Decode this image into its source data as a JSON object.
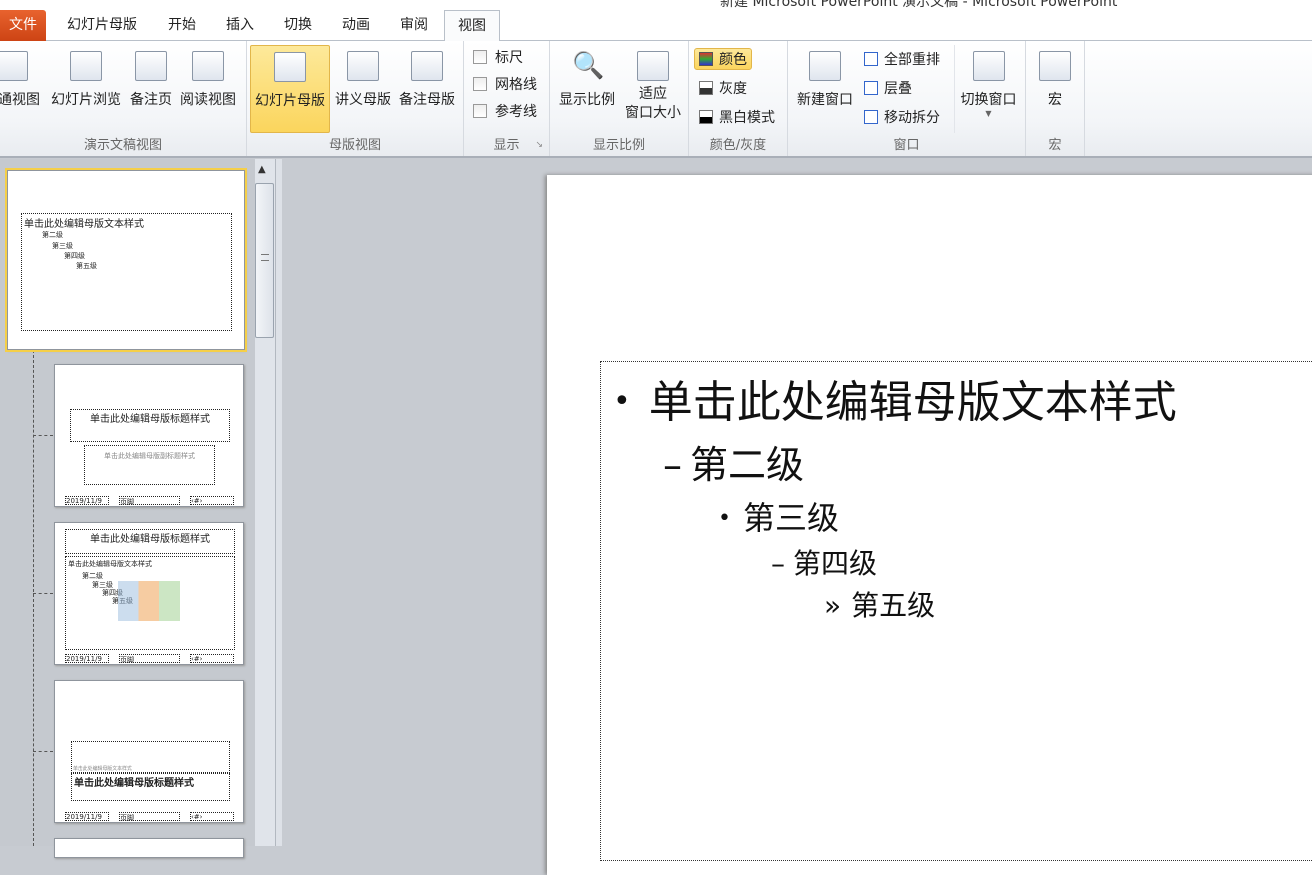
{
  "window": {
    "title": "新建 Microsoft PowerPoint 演示文稿 - Microsoft PowerPoint"
  },
  "tabs": {
    "file": "文件",
    "items": [
      "幻灯片母版",
      "开始",
      "插入",
      "切换",
      "动画",
      "审阅",
      "视图"
    ],
    "active": "视图"
  },
  "ribbon": {
    "presentation_views": {
      "label": "演示文稿视图",
      "buttons": [
        "普通视图",
        "幻灯片浏览",
        "备注页",
        "阅读视图"
      ]
    },
    "master_views": {
      "label": "母版视图",
      "buttons": [
        "幻灯片母版",
        "讲义母版",
        "备注母版"
      ],
      "selected": "幻灯片母版"
    },
    "show": {
      "label": "显示",
      "checkboxes": [
        {
          "label": "标尺",
          "checked": false
        },
        {
          "label": "网格线",
          "checked": false
        },
        {
          "label": "参考线",
          "checked": false
        }
      ]
    },
    "zoom": {
      "label": "显示比例",
      "zoom_button": "显示比例",
      "fit_line1": "适应",
      "fit_line2": "窗口大小"
    },
    "color": {
      "label": "颜色/灰度",
      "options": [
        "颜色",
        "灰度",
        "黑白模式"
      ],
      "selected": "颜色"
    },
    "window": {
      "label": "窗口",
      "new_window": "新建窗口",
      "arrange_all": "全部重排",
      "cascade": "层叠",
      "move_split": "移动拆分",
      "switch_windows": "切换窗口"
    },
    "macros": {
      "label": "宏",
      "button": "宏"
    }
  },
  "thumbnails": {
    "body_levels": [
      "单击此处编辑母版文本样式",
      "第二级",
      "第三级",
      "第四级",
      "第五级"
    ],
    "title": "单击此处编辑母版标题样式",
    "subtitle": "单击此处编辑母版副标题样式",
    "text_style": "单击此处编辑母版文本样式",
    "date": "2019/11/9",
    "footer": "页脚",
    "num": "‹#›"
  },
  "slide": {
    "levels": [
      {
        "bullet": "•",
        "text": "单击此处编辑母版文本样式"
      },
      {
        "bullet": "–",
        "text": "第二级"
      },
      {
        "bullet": "•",
        "text": "第三级"
      },
      {
        "bullet": "–",
        "text": "第四级"
      },
      {
        "bullet": "»",
        "text": "第五级"
      }
    ]
  }
}
